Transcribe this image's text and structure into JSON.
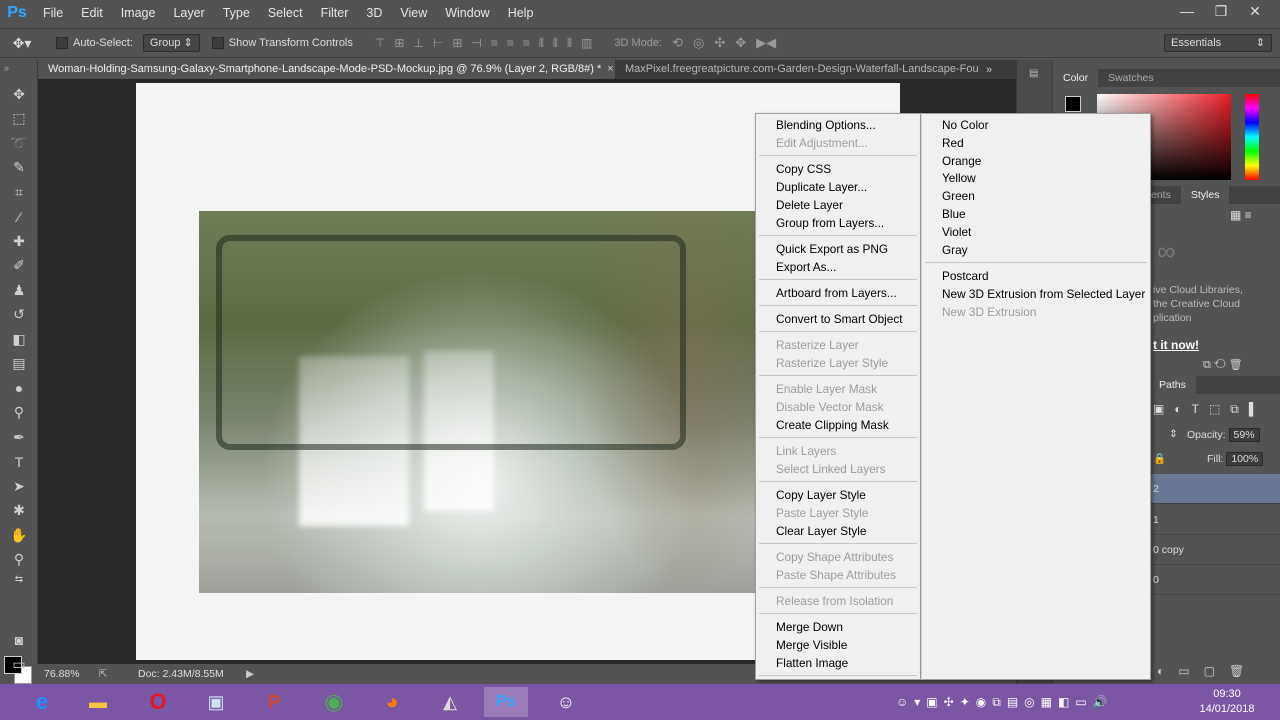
{
  "app": {
    "logo": "Ps"
  },
  "menu": [
    "File",
    "Edit",
    "Image",
    "Layer",
    "Type",
    "Select",
    "Filter",
    "3D",
    "View",
    "Window",
    "Help"
  ],
  "window_controls": {
    "minimize": "—",
    "restore": "❐",
    "close": "✕"
  },
  "options_bar": {
    "auto_select_label": "Auto-Select:",
    "auto_select_value": "Group",
    "show_transform_label": "Show Transform Controls",
    "mode_3d_label": "3D Mode:",
    "workspace": "Essentials"
  },
  "tabs": [
    {
      "label": "Woman-Holding-Samsung-Galaxy-Smartphone-Landscape-Mode-PSD-Mockup.jpg @ 76.9% (Layer 2, RGB/8#) *",
      "close": "×"
    },
    {
      "label": "MaxPixel.freegreatpicture.com-Garden-Design-Waterfall-Landscape-Fou"
    }
  ],
  "tab_overflow": "»",
  "status": {
    "zoom": "76.88%",
    "doc": "Doc: 2.43M/8.55M"
  },
  "panels": {
    "color_tab": "Color",
    "swatches_tab": "Swatches",
    "adjustments_tab_partial": "ents",
    "styles_tab": "Styles",
    "cc_line1": "ive Cloud Libraries,",
    "cc_line2": "the Creative Cloud",
    "cc_line3": "plication",
    "cc_cta": "t it now!",
    "paths_tab": "Paths",
    "opacity_label": "Opacity:",
    "opacity_value": "59%",
    "fill_label": "Fill:",
    "fill_value": "100%",
    "layers": [
      "2",
      "1",
      "0 copy",
      "0"
    ]
  },
  "context_menu": {
    "items": [
      {
        "label": "Blending Options...",
        "enabled": true
      },
      {
        "label": "Edit Adjustment...",
        "enabled": false
      },
      {
        "label": "Copy CSS",
        "enabled": true
      },
      {
        "label": "Duplicate Layer...",
        "enabled": true
      },
      {
        "label": "Delete Layer",
        "enabled": true
      },
      {
        "label": "Group from Layers...",
        "enabled": true
      },
      {
        "label": "Quick Export as PNG",
        "enabled": true
      },
      {
        "label": "Export As...",
        "enabled": true
      },
      {
        "label": "Artboard from Layers...",
        "enabled": true
      },
      {
        "label": "Convert to Smart Object",
        "enabled": true
      },
      {
        "label": "Rasterize Layer",
        "enabled": false
      },
      {
        "label": "Rasterize Layer Style",
        "enabled": false
      },
      {
        "label": "Enable Layer Mask",
        "enabled": false
      },
      {
        "label": "Disable Vector Mask",
        "enabled": false
      },
      {
        "label": "Create Clipping Mask",
        "enabled": true
      },
      {
        "label": "Link Layers",
        "enabled": false
      },
      {
        "label": "Select Linked Layers",
        "enabled": false
      },
      {
        "label": "Copy Layer Style",
        "enabled": true
      },
      {
        "label": "Paste Layer Style",
        "enabled": false
      },
      {
        "label": "Clear Layer Style",
        "enabled": true
      },
      {
        "label": "Copy Shape Attributes",
        "enabled": false
      },
      {
        "label": "Paste Shape Attributes",
        "enabled": false
      },
      {
        "label": "Release from Isolation",
        "enabled": false
      },
      {
        "label": "Merge Down",
        "enabled": true
      },
      {
        "label": "Merge Visible",
        "enabled": true
      },
      {
        "label": "Flatten Image",
        "enabled": true
      }
    ],
    "submenu": [
      {
        "label": "No Color",
        "enabled": true
      },
      {
        "label": "Red",
        "enabled": true
      },
      {
        "label": "Orange",
        "enabled": true
      },
      {
        "label": "Yellow",
        "enabled": true
      },
      {
        "label": "Green",
        "enabled": true
      },
      {
        "label": "Blue",
        "enabled": true
      },
      {
        "label": "Violet",
        "enabled": true
      },
      {
        "label": "Gray",
        "enabled": true
      },
      {
        "label": "Postcard",
        "enabled": true
      },
      {
        "label": "New 3D Extrusion from Selected Layer",
        "enabled": true
      },
      {
        "label": "New 3D Extrusion",
        "enabled": false
      }
    ]
  },
  "taskbar": {
    "time": "09:30",
    "date": "14/01/2018"
  },
  "colors": {
    "accent": "#31a8ff",
    "taskbar": "#7b56a4",
    "selected_layer": "#6a7893"
  }
}
